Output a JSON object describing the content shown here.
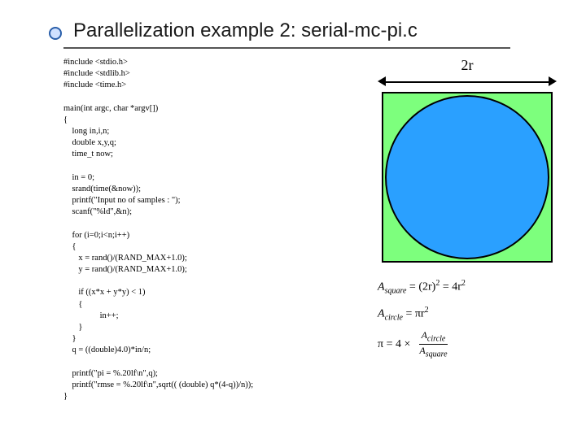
{
  "title": "Parallelization example 2: serial-mc-pi.c",
  "code": "#include <stdio.h>\n#include <stdlib.h>\n#include <time.h>\n\nmain(int argc, char *argv[])\n{\n    long in,i,n;\n    double x,y,q;\n    time_t now;\n\n    in = 0;\n    srand(time(&now));\n    printf(\"Input no of samples : \");\n    scanf(\"%ld\",&n);\n\n    for (i=0;i<n;i++)\n    {\n       x = rand()/(RAND_MAX+1.0);\n       y = rand()/(RAND_MAX+1.0);\n\n       if ((x*x + y*y) < 1)\n       {\n                 in++;\n       }\n    }\n    q = ((double)4.0)*in/n;\n\n    printf(\"pi = %.20lf\\n\",q);\n    printf(\"rmse = %.20lf\\n\",sqrt(( (double) q*(4-q))/n));\n}",
  "diagram": {
    "width_label": "2r"
  },
  "formulas": {
    "A_square_lhs": "A",
    "A_square_sub": "square",
    "A_square_rhs_a": "= (2r)",
    "A_square_rhs_b": "= 4r",
    "A_circle_lhs": "A",
    "A_circle_sub": "circle",
    "A_circle_rhs": "= πr",
    "pi_lhs": "π = 4 ×",
    "frac_num_A": "A",
    "frac_num_sub": "circle",
    "frac_den_A": "A",
    "frac_den_sub": "square",
    "two": "2"
  }
}
